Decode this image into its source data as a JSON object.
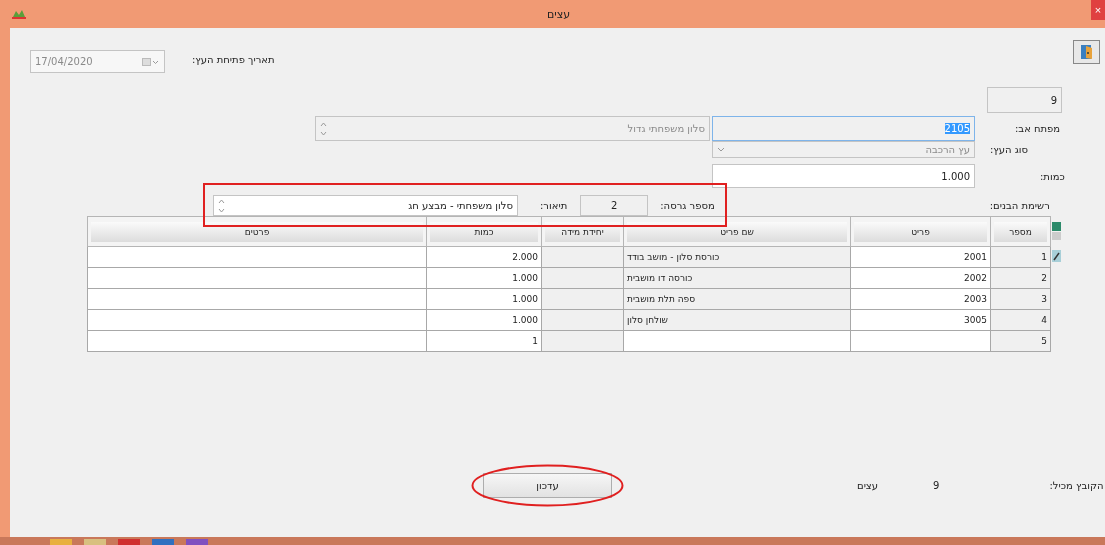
{
  "window": {
    "title": "עצים",
    "close": "×"
  },
  "open_date": {
    "label": "תאריך פתיחת העץ:",
    "value": "17/04/2020",
    "disabled": true
  },
  "id_field": {
    "value": "9"
  },
  "parent_key": {
    "label": "מפתח אב:",
    "value": "2105",
    "selected": true
  },
  "parent_name": {
    "value": "סלון משפחתי גדול"
  },
  "tree_type": {
    "label": "סוג העץ:",
    "value": "עץ הרכבה",
    "disabled": true
  },
  "quantity": {
    "label": "כמות:",
    "value": "1.000"
  },
  "children_label": "רשימת הבנים:",
  "version": {
    "label": "מספר גרסה:",
    "value": "2",
    "highlighted": true
  },
  "description": {
    "label": "תיאור:",
    "value": "סלון משפחתי - מבצע חג"
  },
  "table": {
    "columns": [
      "מספר",
      "פריט",
      "שם פריט",
      "יחידת מידה",
      "כמות",
      "פרטים"
    ],
    "rows": [
      {
        "number": "1",
        "item": "2001",
        "name": "כורסת סלון - מושב בודד",
        "quantity": "2.000",
        "current": true
      },
      {
        "number": "2",
        "item": "2002",
        "name": "כורסה דו מושבית",
        "quantity": "1.000",
        "current": false
      },
      {
        "number": "3",
        "item": "2003",
        "name": "ספה תלת מושבית",
        "quantity": "1.000",
        "current": false
      },
      {
        "number": "4",
        "item": "3005",
        "name": "שולחן סלון",
        "quantity": "1.000",
        "current": false
      },
      {
        "number": "5",
        "quantity": "1",
        "current": false
      }
    ]
  },
  "footer": {
    "label": "הקובץ מכיל:",
    "count": "9",
    "unit": "עצים"
  },
  "update_button": {
    "label": "עדכון",
    "highlighted": true
  }
}
